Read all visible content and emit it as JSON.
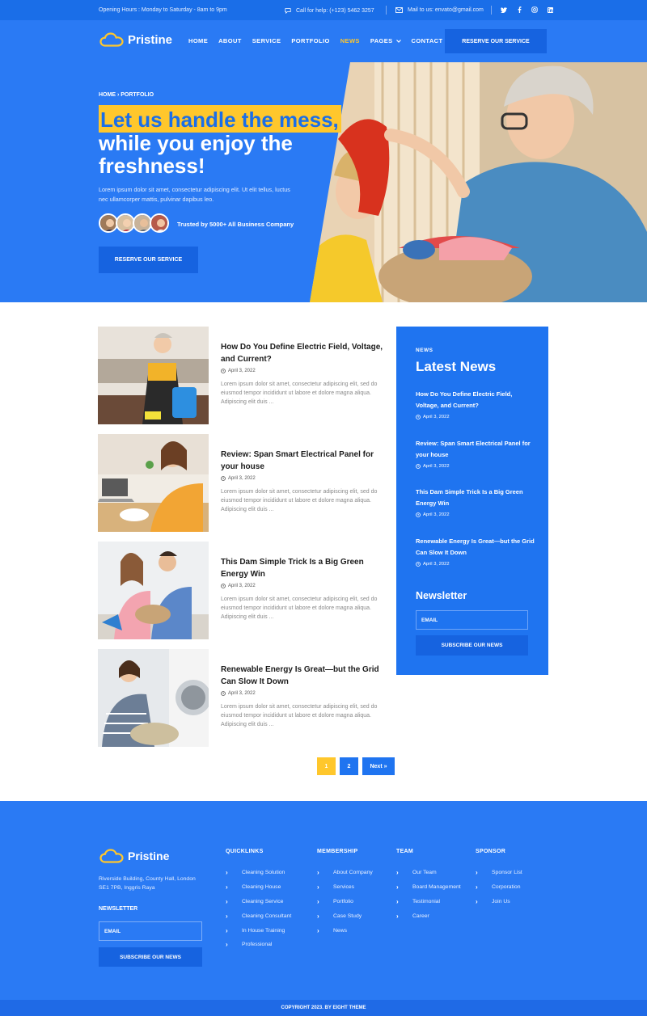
{
  "topbar": {
    "hours": "Opening Hours : Monday to Saturday - 8am to 9pm",
    "help": "Call for help: (+123) 5462 3257",
    "mail": "Mail to us: envato@gmail.com",
    "socials": [
      "twitter-icon",
      "facebook-icon",
      "instagram-icon",
      "linkedin-icon"
    ]
  },
  "header": {
    "brand": "Pristine",
    "nav": [
      "HOME",
      "ABOUT",
      "SERVICE",
      "PORTFOLIO",
      "NEWS",
      "PAGES",
      "CONTACT"
    ],
    "active_nav": "NEWS",
    "reserve": "RESERVE OUR SERVICE"
  },
  "hero": {
    "breadcrumb": "HOME › PORTFOLIO",
    "headline_highlight": "Let us handle the mess,",
    "headline_rest": "while you enjoy the freshness!",
    "description": "Lorem ipsum dolor sit amet, consectetur adipiscing elit. Ut elit tellus, luctus nec ullamcorper mattis, pulvinar dapibus leo.",
    "trusted": "Trusted by 5000+ All Business Company",
    "cta": "RESERVE OUR SERVICE"
  },
  "posts": [
    {
      "title": "How Do You Define Electric Field, Voltage, and Current?",
      "date": "April 3, 2022",
      "excerpt": "Lorem ipsum dolor sit amet, consectetur adipiscing elit, sed do eiusmod tempor incididunt ut labore et dolore magna aliqua. Adipiscing elit duis ..."
    },
    {
      "title": "Review: Span Smart Electrical Panel for your house",
      "date": "April 3, 2022",
      "excerpt": "Lorem ipsum dolor sit amet, consectetur adipiscing elit, sed do eiusmod tempor incididunt ut labore et dolore magna aliqua. Adipiscing elit duis ..."
    },
    {
      "title": "This Dam Simple Trick Is a Big Green Energy Win",
      "date": "April 3, 2022",
      "excerpt": "Lorem ipsum dolor sit amet, consectetur adipiscing elit, sed do eiusmod tempor incididunt ut labore et dolore magna aliqua. Adipiscing elit duis ..."
    },
    {
      "title": "Renewable Energy Is Great—but the Grid Can Slow It Down",
      "date": "April 3, 2022",
      "excerpt": "Lorem ipsum dolor sit amet, consectetur adipiscing elit, sed do eiusmod tempor incididunt ut labore et dolore magna aliqua. Adipiscing elit duis ..."
    }
  ],
  "pagination": {
    "pages": [
      "1",
      "2"
    ],
    "current": "1",
    "next": "Next »"
  },
  "sidebar": {
    "label": "NEWS",
    "title": "Latest News",
    "items": [
      {
        "title": "How Do You Define Electric Field, Voltage, and Current?",
        "date": "April 3, 2022"
      },
      {
        "title": "Review: Span Smart Electrical Panel for your house",
        "date": "April 3, 2022"
      },
      {
        "title": "This Dam Simple Trick Is a Big Green Energy Win",
        "date": "April 3, 2022"
      },
      {
        "title": "Renewable Energy Is Great—but the Grid Can Slow It Down",
        "date": "April 3, 2022"
      }
    ],
    "newsletter_title": "Newsletter",
    "email_placeholder": "EMAIL",
    "subscribe": "SUBSCRIBE OUR NEWS"
  },
  "footer": {
    "brand": "Pristine",
    "address": "Riverside Building, County Hall, London SE1 7PB, Inggris Raya",
    "newsletter_label": "NEWSLETTER",
    "email_placeholder": "EMAIL",
    "subscribe": "SUBSCRIBE OUR NEWS",
    "columns": [
      {
        "heading": "QUICKLINKS",
        "links": [
          "Cleaning Solution",
          "Cleaning House",
          "Cleaning Service",
          "Cleaning Consultant",
          "In House Training",
          "Professional"
        ]
      },
      {
        "heading": "MEMBERSHIP",
        "links": [
          "About Company",
          "Services",
          "Portfolio",
          "Case Study",
          "News"
        ]
      },
      {
        "heading": "TEAM",
        "links": [
          "Our Team",
          "Board Management",
          "Testimonial",
          "Career"
        ]
      },
      {
        "heading": "SPONSOR",
        "links": [
          "Sponsor List",
          "Corporation",
          "Join Us"
        ]
      }
    ],
    "copyright": "COPYRIGHT 2023. BY EIGHT THEME"
  },
  "colors": {
    "primary": "#2a7af4",
    "dark_primary": "#1663e0",
    "accent": "#ffc72c"
  }
}
